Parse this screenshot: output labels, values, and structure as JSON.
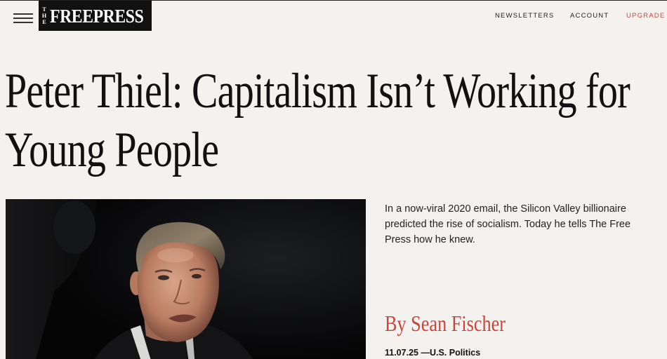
{
  "header": {
    "menu_icon": "hamburger-menu-icon",
    "logo": {
      "the_letters": [
        "T",
        "H",
        "E"
      ],
      "name": "FREEPRESS"
    },
    "nav": {
      "newsletters": "NEWSLETTERS",
      "account": "ACCOUNT",
      "upgrade": "UPGRADE"
    },
    "accent_color": "#c9463d"
  },
  "article": {
    "headline_lines": [
      "Peter Thiel: Capitalism Isn’t Working for",
      "Young People"
    ],
    "dek": "In a now-viral 2020 email, the Silicon Valley billionaire predicted the rise of socialism. Today he tells The Free Press how he knew.",
    "byline": "By Sean Fischer",
    "date": "11.07.25",
    "separator": "—",
    "section": "U.S. Politics"
  }
}
